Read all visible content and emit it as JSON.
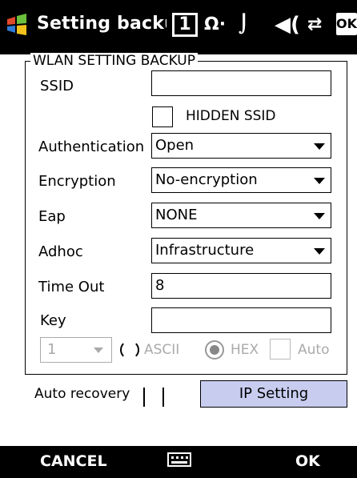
{
  "titlebar": {
    "title": "Setting backup",
    "sim_label": "1",
    "ok_label": "OK",
    "icons": [
      "windows-logo-icon",
      "sim-card-icon",
      "signal-icon",
      "battery-icon",
      "speaker-icon",
      "connection-icon"
    ]
  },
  "group": {
    "legend": "WLAN SETTING BACKUP",
    "ssid_label": "SSID",
    "ssid_value": "",
    "hidden_ssid_label": "HIDDEN SSID",
    "hidden_ssid_checked": false,
    "auth_label": "Authentication",
    "auth_value": "Open",
    "enc_label": "Encryption",
    "enc_value": "No-encryption",
    "eap_label": "Eap",
    "eap_value": "NONE",
    "adhoc_label": "Adhoc",
    "adhoc_value": "Infrastructure",
    "timeout_label": "Time Out",
    "timeout_value": "8",
    "key_label": "Key",
    "key_value": "",
    "key_index_value": "1",
    "ascii_label": "ASCII",
    "hex_label": "HEX",
    "auto_label": "Auto",
    "hex_selected": true
  },
  "bottom": {
    "auto_recovery_label": "Auto recovery",
    "ip_setting_label": "IP Setting"
  },
  "softkeys": {
    "left": "CANCEL",
    "right": "OK"
  }
}
